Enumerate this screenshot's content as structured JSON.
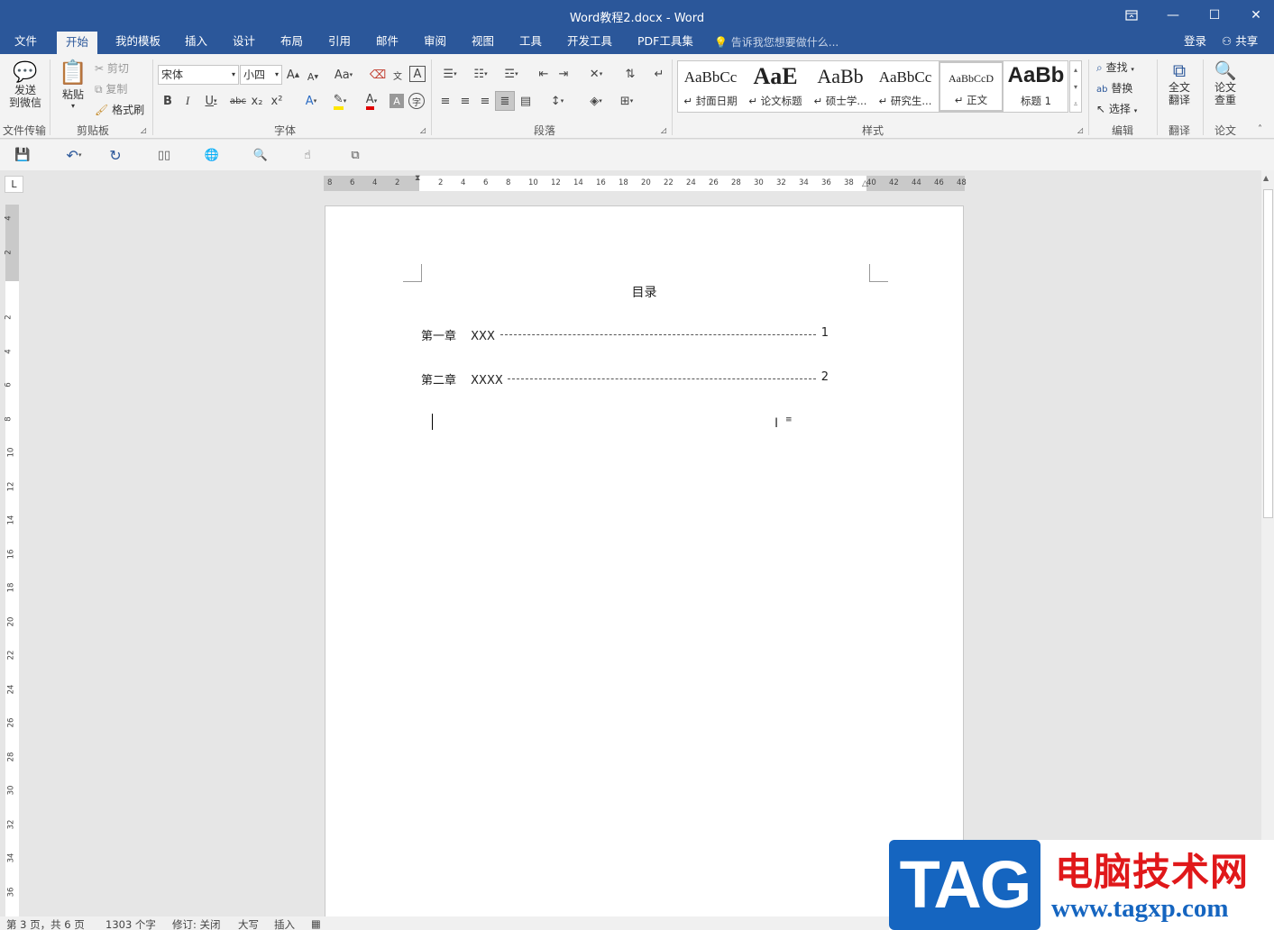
{
  "window": {
    "title": "Word教程2.docx - Word",
    "restore_icon": "ribbon-display-icon",
    "min_label": "—",
    "max_label": "☐",
    "close_label": "✕"
  },
  "tabs": [
    "文件",
    "开始",
    "我的模板",
    "插入",
    "设计",
    "布局",
    "引用",
    "邮件",
    "审阅",
    "视图",
    "工具",
    "开发工具",
    "PDF工具集"
  ],
  "active_tab": "开始",
  "tell_me": "告诉我您想要做什么...",
  "account": {
    "login": "登录",
    "share": "共享"
  },
  "ribbon": {
    "file_transfer": {
      "btn": "发送\n到微信",
      "line1": "发送",
      "line2": "到微信",
      "group": "文件传输"
    },
    "clipboard": {
      "paste": "粘贴",
      "cut": "剪切",
      "copy": "复制",
      "format_painter": "格式刷",
      "group": "剪贴板"
    },
    "font": {
      "name": "宋体",
      "size": "小四",
      "group": "字体",
      "grow": "A",
      "shrink": "A",
      "case": "Aa",
      "bold": "B",
      "italic": "I",
      "underline": "U",
      "strike": "abc",
      "sub": "x₂",
      "sup": "x²"
    },
    "paragraph": {
      "group": "段落"
    },
    "styles": {
      "group": "样式",
      "items": [
        {
          "preview": "AaBbCc",
          "name": "↵ 封面日期"
        },
        {
          "preview": "AaE",
          "name": "↵ 论文标题"
        },
        {
          "preview": "AaBb",
          "name": "↵ 硕士学..."
        },
        {
          "preview": "AaBbCc",
          "name": "↵ 研究生..."
        },
        {
          "preview": "AaBbCcD",
          "name": "↵ 正文"
        },
        {
          "preview": "AaBb",
          "name": "标题 1"
        }
      ]
    },
    "editing": {
      "find": "查找",
      "replace": "替换",
      "select": "选择",
      "group": "编辑"
    },
    "translate": {
      "btn1": "全文",
      "btn2": "翻译",
      "group": "翻译"
    },
    "paper": {
      "btn1": "论文",
      "btn2": "查重",
      "group": "论文"
    }
  },
  "ruler": {
    "h_left": [
      "8",
      "6",
      "4",
      "2"
    ],
    "h_right": [
      "2",
      "4",
      "6",
      "8",
      "10",
      "12",
      "14",
      "16",
      "18",
      "20",
      "22",
      "24",
      "26",
      "28",
      "30",
      "32",
      "34",
      "36",
      "38",
      "40",
      "42",
      "44",
      "46",
      "48"
    ],
    "v_top": [
      "4",
      "2"
    ],
    "v_main": [
      "2",
      "4",
      "6",
      "8",
      "10",
      "12",
      "14",
      "16",
      "18",
      "20",
      "22",
      "24",
      "26",
      "28",
      "30",
      "32",
      "34",
      "36"
    ],
    "tab_selector": "L"
  },
  "document": {
    "heading": "目录",
    "toc": [
      {
        "chapter": "第一章",
        "title": "XXX",
        "page": "1"
      },
      {
        "chapter": "第二章",
        "title": "XXXX",
        "page": "2"
      }
    ]
  },
  "status": {
    "page": "第 3 页，共 6 页",
    "words": "1303 个字",
    "track": "修订: 关闭",
    "caps": "大写",
    "insert": "插入"
  },
  "watermark": {
    "tag": "TAG",
    "cn": "电脑技术网",
    "url": "www.tagxp.com"
  },
  "colors": {
    "brand": "#2b579a",
    "watermark_blue": "#1565c0",
    "watermark_red": "#e0181a"
  }
}
